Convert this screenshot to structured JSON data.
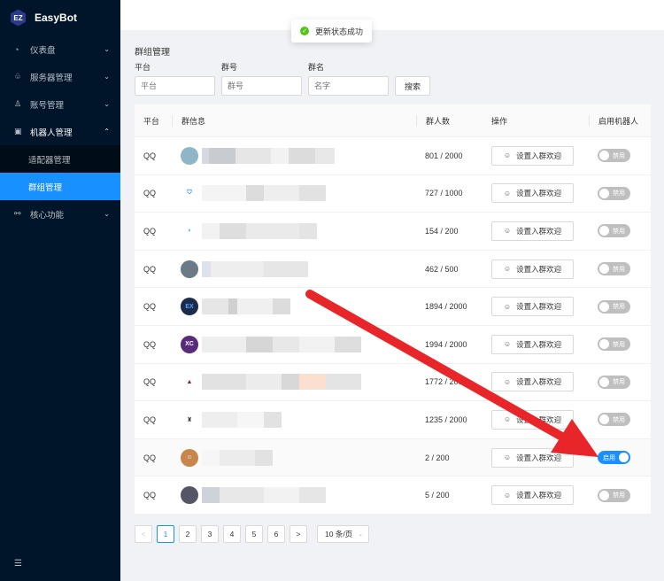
{
  "app": {
    "logo_mark": "EZ",
    "name": "EasyBot"
  },
  "sidebar": {
    "items": [
      {
        "label": "仪表盘",
        "icon": "dashboard-icon",
        "glyph": "◔"
      },
      {
        "label": "服务器管理",
        "icon": "server-icon",
        "glyph": "♧"
      },
      {
        "label": "账号管理",
        "icon": "account-icon",
        "glyph": "♙"
      },
      {
        "label": "机器人管理",
        "icon": "robot-icon",
        "glyph": "▣"
      },
      {
        "label": "核心功能",
        "icon": "core-icon",
        "glyph": "⚯"
      }
    ],
    "subitems": [
      {
        "label": "适配器管理"
      },
      {
        "label": "群组管理"
      }
    ],
    "collapse_glyph": "☰"
  },
  "toast": {
    "text": "更新状态成功",
    "status_color": "#52c41a"
  },
  "page": {
    "title": "群组管理",
    "filters": {
      "platform": {
        "label": "平台",
        "placeholder": "平台"
      },
      "group_id": {
        "label": "群号",
        "placeholder": "群号"
      },
      "name": {
        "label": "群名",
        "placeholder": "名字"
      },
      "search_label": "搜索"
    }
  },
  "table": {
    "headers": {
      "platform": "平台",
      "info": "群信息",
      "members": "群人数",
      "actions": "操作",
      "enable": "启用机器人"
    },
    "action_label": "设置入群欢迎",
    "off_label": "禁用",
    "on_label": "启用",
    "rows": [
      {
        "platform": "QQ",
        "members": "801 / 2000",
        "enabled": false
      },
      {
        "platform": "QQ",
        "members": "727 / 1000",
        "enabled": false
      },
      {
        "platform": "QQ",
        "members": "154 / 200",
        "enabled": false
      },
      {
        "platform": "QQ",
        "members": "462 / 500",
        "enabled": false
      },
      {
        "platform": "QQ",
        "members": "1894 / 2000",
        "enabled": false
      },
      {
        "platform": "QQ",
        "members": "1994 / 2000",
        "enabled": false
      },
      {
        "platform": "QQ",
        "members": "1772 / 2000",
        "enabled": false
      },
      {
        "platform": "QQ",
        "members": "1235 / 2000",
        "enabled": false
      },
      {
        "platform": "QQ",
        "members": "2 / 200",
        "enabled": true
      },
      {
        "platform": "QQ",
        "members": "5 / 200",
        "enabled": false
      }
    ]
  },
  "pagination": {
    "prev": "<",
    "next": ">",
    "pages": [
      "1",
      "2",
      "3",
      "4",
      "5",
      "6"
    ],
    "current": "1",
    "page_size": "10 条/页"
  },
  "colors": {
    "primary": "#1890ff",
    "sidebar_bg": "#001529",
    "arrow": "#e8262a"
  }
}
